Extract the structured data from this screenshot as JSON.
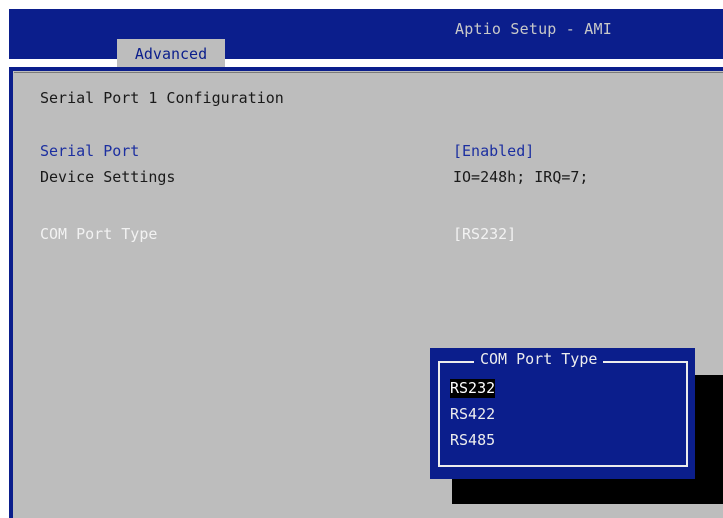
{
  "header": {
    "title": "Aptio Setup - AMI",
    "tabs": [
      {
        "label": "Advanced",
        "active": true
      }
    ]
  },
  "main": {
    "section_title": "Serial Port 1 Configuration",
    "items": [
      {
        "label": "Serial Port",
        "value": "[Enabled]"
      },
      {
        "label": "Device Settings",
        "value": "IO=248h; IRQ=7;"
      },
      {
        "label": "COM Port Type",
        "value": "[RS232]"
      }
    ]
  },
  "popup": {
    "title": "COM Port Type",
    "options": [
      "RS232",
      "RS422",
      "RS485"
    ],
    "selected": "RS232"
  },
  "colors": {
    "bios_blue": "#0B1E8C",
    "panel_gray": "#BDBDBD",
    "highlight_label": "#1C2FA0",
    "popup_text": "#EDEDED"
  }
}
